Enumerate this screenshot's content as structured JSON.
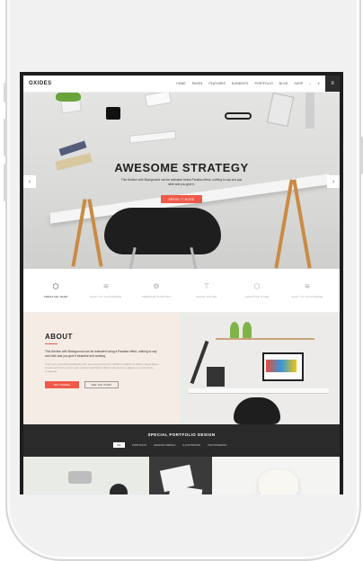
{
  "site": {
    "logo": "OXIDES",
    "menu": [
      "HOME",
      "PAGES",
      "FEATURES",
      "ELEMENTS",
      "PORTFOLIO",
      "BLOG",
      "SHOP"
    ],
    "hamburger": "≡"
  },
  "hero": {
    "title": "AWESOME STRATEGY",
    "subtitle": "This Section with Background can be activated below Parallax effect, nothing to say and just slide and you give it.",
    "cta": "BREAK IT MORE",
    "prev": "‹",
    "next": "›"
  },
  "features": [
    {
      "icon": "hexagon-icon",
      "label": "CREATIVE TEAM"
    },
    {
      "icon": "stack-icon",
      "label": "EASY TO CUSTOMIZE"
    },
    {
      "icon": "gear-icon",
      "label": "PREMIUM SUPPORT"
    },
    {
      "icon": "brush-icon",
      "label": "MADE ONLINE"
    },
    {
      "icon": "hexagon-icon",
      "label": "CREATIVE CODE"
    },
    {
      "icon": "stack-icon",
      "label": "EASY TO CUSTOMIZE"
    }
  ],
  "about": {
    "title": "ABOUT",
    "text1": "This Section with Background can be animated using a Parallax effect, nothing to say and click and you give it beautiful and working.",
    "text2": "Anam est, consectetur adipisicing elit, sed eiusmod tempor incididunt ut labore et dolore magna aliqua. Ut enim ad minim veniam, quis nostrud exercitation ullamco laboris nisi ut aliquip ex ea commodo consequat.",
    "btn_primary": "BUY OXIDES",
    "btn_secondary": "SEE THE WORK"
  },
  "portfolio": {
    "title": "SPECIAL PORTFOLIO DESIGN",
    "filters": [
      "ALL",
      "PORTFOLIO",
      "GRAPHIC DESIGN",
      "ILLUSTRATION",
      "PHOTOGRAPHY"
    ]
  }
}
